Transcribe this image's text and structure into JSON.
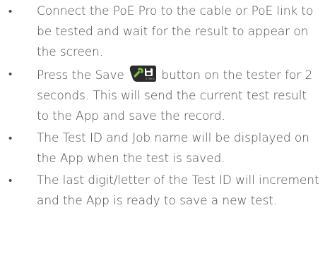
{
  "bullet_symbol": "•",
  "items": [
    {
      "text": "Connect the PoE Pro to the cable or PoE link to be tested and wait for the result to appear on the screen."
    },
    {
      "before": "Press the Save",
      "icon": "wrench-save-button-icon",
      "icon_caption": "2 Secs",
      "after": "button on the tester for 2 seconds. This will send the current test result to the App and save the record."
    },
    {
      "text": "The Test ID and Job name will be displayed on the App when the test is saved."
    },
    {
      "text": "The last digit/letter of the Test ID will increment and the App is ready to save a new test."
    }
  ]
}
